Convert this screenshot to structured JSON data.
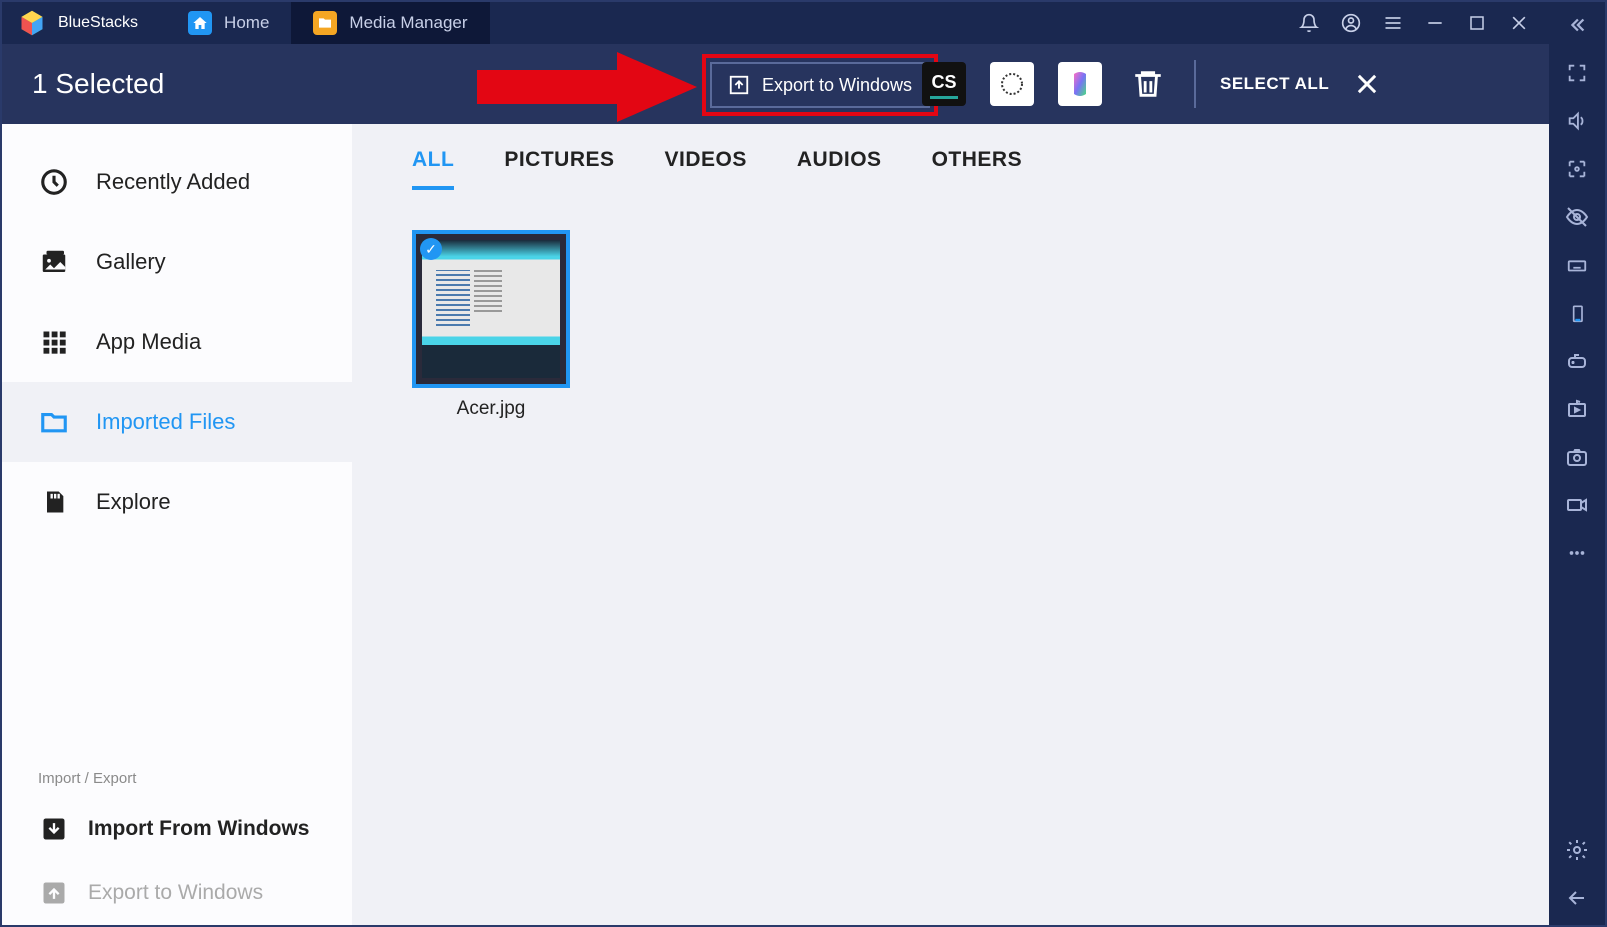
{
  "titlebar": {
    "app_name": "BlueStacks",
    "tabs": [
      {
        "label": "Home",
        "icon": "home"
      },
      {
        "label": "Media Manager",
        "icon": "folder"
      }
    ]
  },
  "selection_bar": {
    "text": "1 Selected",
    "export_label": "Export to Windows",
    "select_all": "SELECT ALL"
  },
  "sidebar": {
    "items": [
      {
        "label": "Recently Added"
      },
      {
        "label": "Gallery"
      },
      {
        "label": "App Media"
      },
      {
        "label": "Imported Files"
      },
      {
        "label": "Explore"
      }
    ],
    "section_label": "Import / Export",
    "actions": [
      {
        "label": "Import From Windows"
      },
      {
        "label": "Export to Windows"
      }
    ]
  },
  "filter_tabs": [
    "ALL",
    "PICTURES",
    "VIDEOS",
    "AUDIOS",
    "OTHERS"
  ],
  "media_items": [
    {
      "name": "Acer.jpg"
    }
  ]
}
